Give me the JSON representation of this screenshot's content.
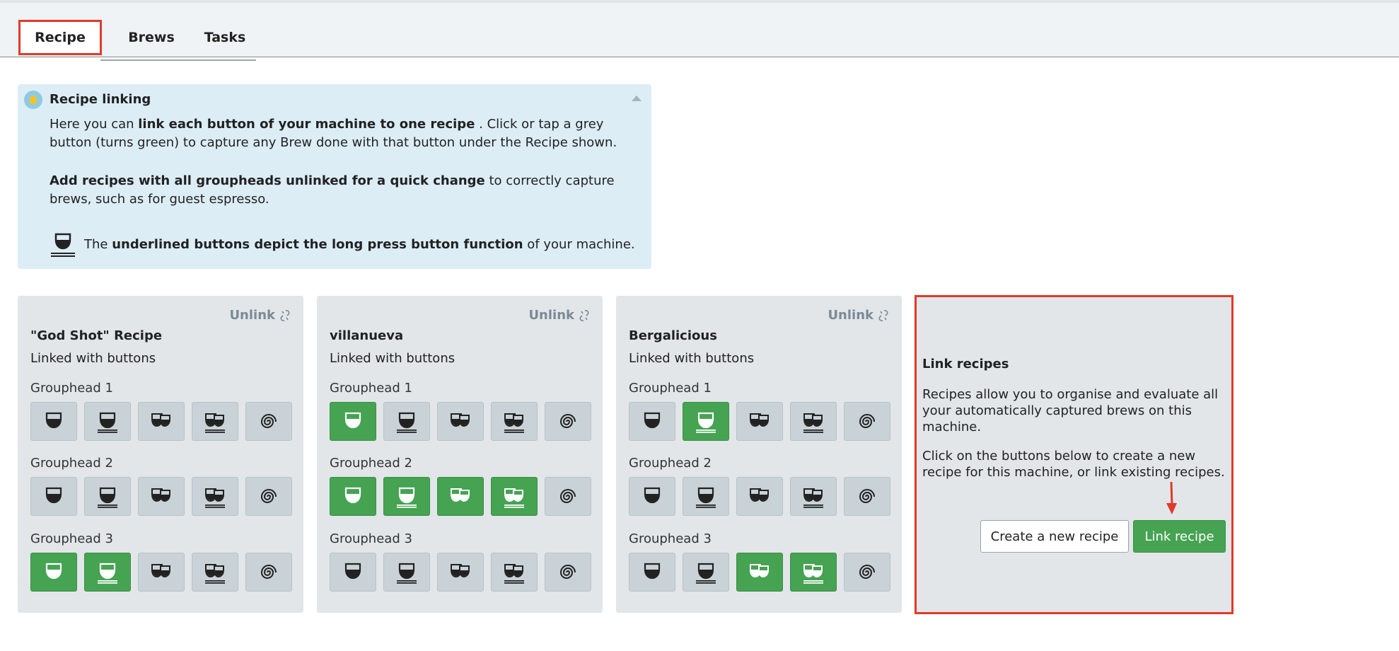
{
  "tabs": [
    {
      "label": "Recipe",
      "active": true
    },
    {
      "label": "Brews",
      "active": false
    },
    {
      "label": "Tasks",
      "active": false
    }
  ],
  "info": {
    "icon": "lightbulb-icon",
    "title": "Recipe linking",
    "p1_a": "Here you can ",
    "p1_b": "link each button of your machine to one recipe",
    "p1_c": " . Click or tap a grey button (turns green) to capture any Brew done with that button under the Recipe shown.",
    "p2_a": "Add recipes with all groupheads unlinked for a quick change",
    "p2_b": " to correctly capture brews, such as for guest espresso.",
    "p3_a": "The ",
    "p3_b": "underlined buttons depict the long press button function",
    "p3_c": " of your machine."
  },
  "cards": [
    {
      "unlink_label": "Unlink",
      "name": "\"God Shot\" Recipe",
      "subtitle": "Linked with buttons",
      "groupheads": [
        {
          "label": "Grouphead 1",
          "active": [
            false,
            false,
            false,
            false,
            false
          ]
        },
        {
          "label": "Grouphead 2",
          "active": [
            false,
            false,
            false,
            false,
            false
          ]
        },
        {
          "label": "Grouphead 3",
          "active": [
            true,
            true,
            false,
            false,
            false
          ]
        }
      ]
    },
    {
      "unlink_label": "Unlink",
      "name": "villanueva",
      "subtitle": "Linked with buttons",
      "groupheads": [
        {
          "label": "Grouphead 1",
          "active": [
            true,
            false,
            false,
            false,
            false
          ]
        },
        {
          "label": "Grouphead 2",
          "active": [
            true,
            true,
            true,
            true,
            false
          ]
        },
        {
          "label": "Grouphead 3",
          "active": [
            false,
            false,
            false,
            false,
            false
          ]
        }
      ]
    },
    {
      "unlink_label": "Unlink",
      "name": "Bergalicious",
      "subtitle": "Linked with buttons",
      "groupheads": [
        {
          "label": "Grouphead 1",
          "active": [
            false,
            true,
            false,
            false,
            false
          ]
        },
        {
          "label": "Grouphead 2",
          "active": [
            false,
            false,
            false,
            false,
            false
          ]
        },
        {
          "label": "Grouphead 3",
          "active": [
            false,
            false,
            true,
            true,
            false
          ]
        }
      ]
    }
  ],
  "button_icons": [
    "single-cup-icon",
    "single-cup-long-icon",
    "double-cup-icon",
    "double-cup-long-icon",
    "steam-spiral-icon"
  ],
  "link_panel": {
    "title": "Link recipes",
    "p1": "Recipes allow you to organise and evaluate all your automatically captured brews on this machine.",
    "p2": "Click on the buttons below to create a new recipe for this machine, or link existing recipes.",
    "create_label": "Create a new recipe",
    "link_label": "Link recipe"
  },
  "colors": {
    "accent_green": "#45a352",
    "highlight_red": "#e03a2a",
    "button_grey": "#c9d2d7",
    "info_bg": "#dcedf6"
  }
}
